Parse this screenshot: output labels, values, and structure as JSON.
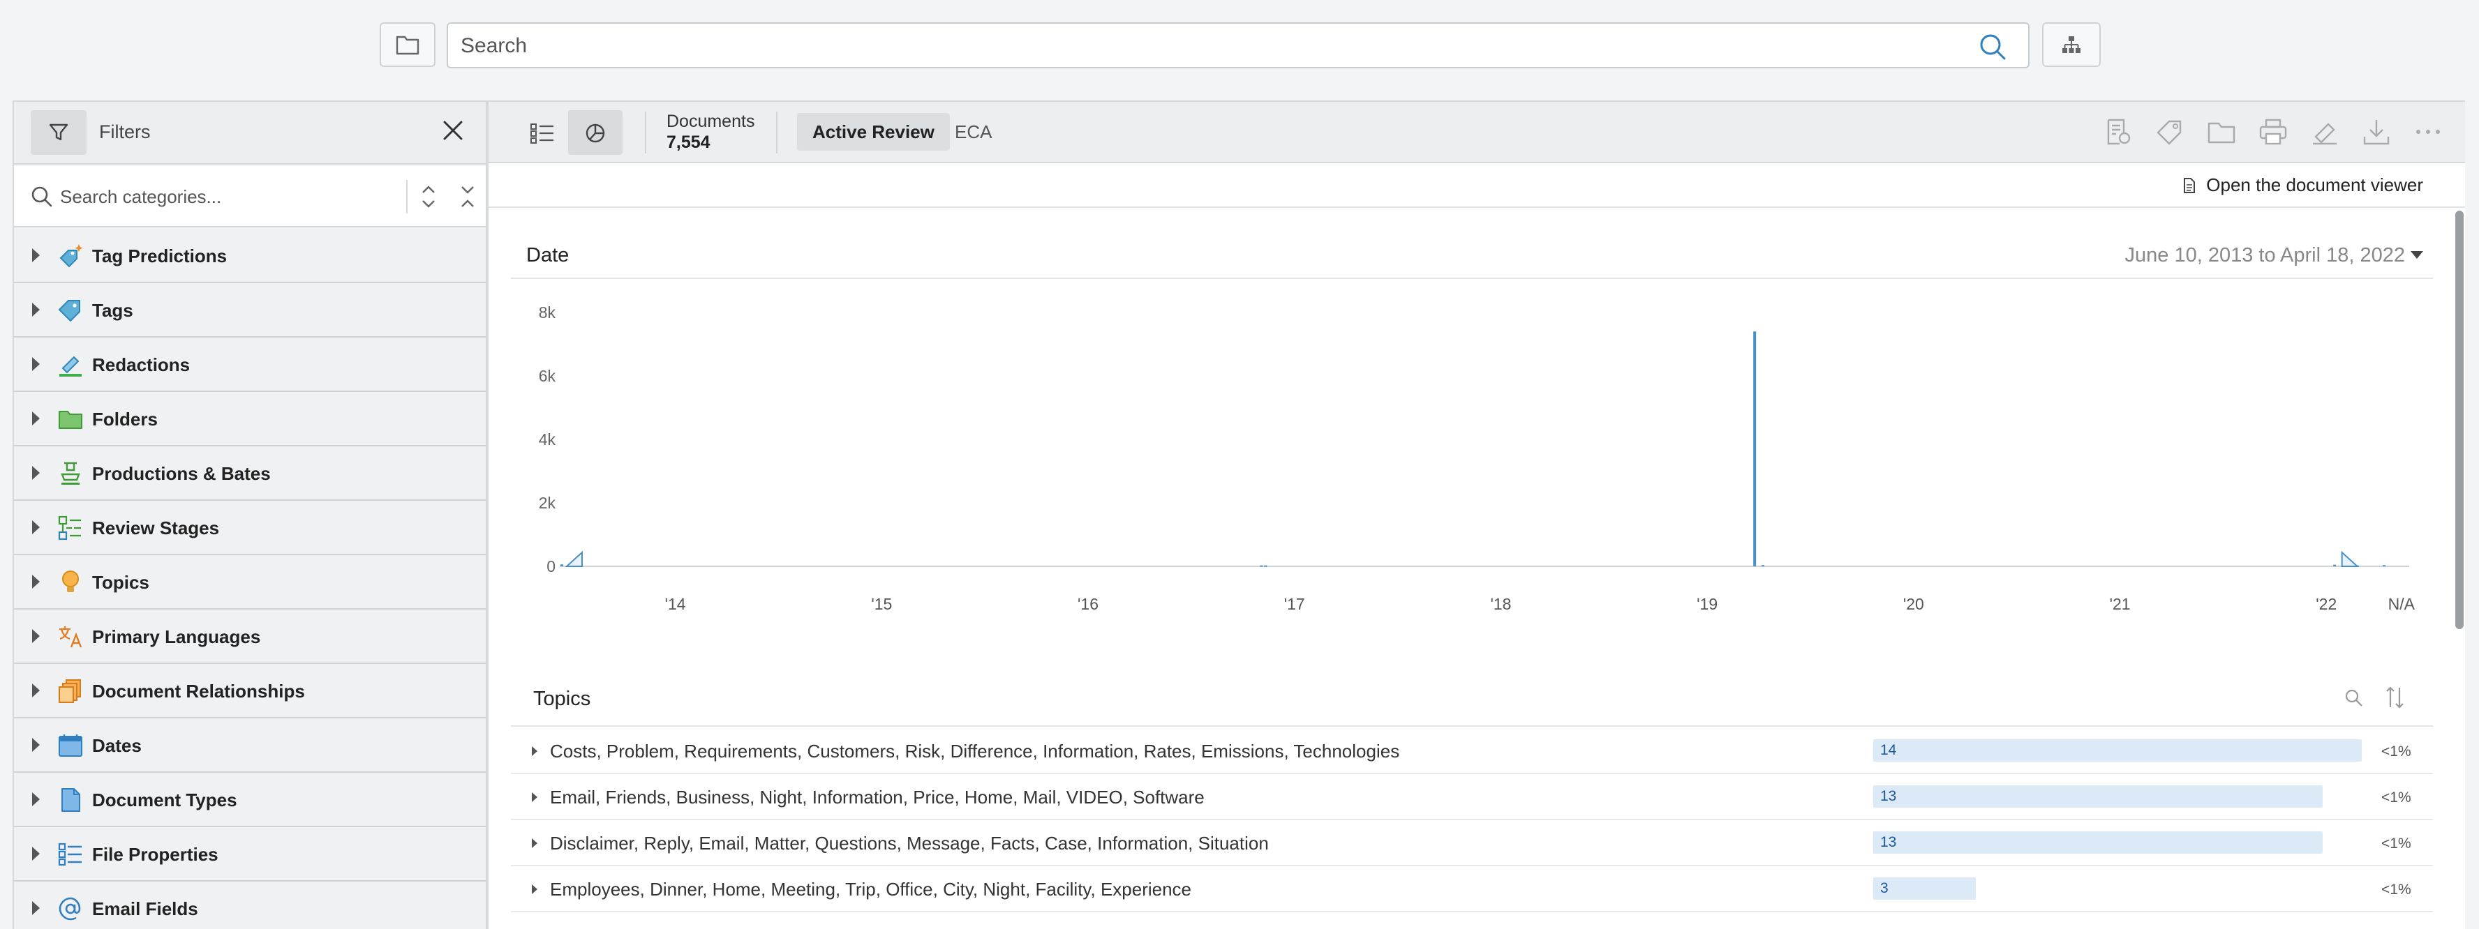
{
  "search": {
    "placeholder": "Search"
  },
  "sidebar": {
    "title": "Filters",
    "search_placeholder": "Search categories...",
    "items": [
      {
        "label": "Tag Predictions",
        "icon": "tag-prediction-icon"
      },
      {
        "label": "Tags",
        "icon": "tag-icon"
      },
      {
        "label": "Redactions",
        "icon": "redaction-marker-icon"
      },
      {
        "label": "Folders",
        "icon": "folder-icon"
      },
      {
        "label": "Productions & Bates",
        "icon": "production-stamp-icon"
      },
      {
        "label": "Review Stages",
        "icon": "review-stages-icon"
      },
      {
        "label": "Topics",
        "icon": "lightbulb-icon"
      },
      {
        "label": "Primary Languages",
        "icon": "language-icon"
      },
      {
        "label": "Document Relationships",
        "icon": "document-relationships-icon"
      },
      {
        "label": "Dates",
        "icon": "calendar-icon"
      },
      {
        "label": "Document Types",
        "icon": "document-type-icon"
      },
      {
        "label": "File Properties",
        "icon": "file-properties-icon"
      },
      {
        "label": "Email Fields",
        "icon": "at-sign-icon"
      }
    ]
  },
  "toolbar": {
    "documents_label": "Documents",
    "documents_count": "7,554",
    "tabs": [
      {
        "label": "Active Review",
        "active": true
      },
      {
        "label": "ECA",
        "active": false
      }
    ],
    "actions": [
      "document-assign-icon",
      "tag-icon",
      "folder-icon",
      "print-icon",
      "redact-icon",
      "download-icon",
      "more-icon"
    ]
  },
  "viewer": {
    "open_label": "Open the document viewer"
  },
  "date_panel": {
    "title": "Date",
    "range": "June 10, 2013 to April 18, 2022"
  },
  "chart_data": {
    "type": "bar",
    "title": "Date",
    "xlabel": "",
    "ylabel": "",
    "y_ticks": [
      "0",
      "2k",
      "4k",
      "6k",
      "8k"
    ],
    "x_ticks": [
      "'14",
      "'15",
      "'16",
      "'17",
      "'18",
      "'19",
      "'20",
      "'21",
      "'22",
      "N/A"
    ],
    "ylim": [
      0,
      8000
    ],
    "xlim": [
      2013.44,
      2022.3
    ],
    "series": [
      {
        "values": [
          {
            "x": 2013.45,
            "y": 60
          },
          {
            "x": 2016.84,
            "y": 30
          },
          {
            "x": 2016.86,
            "y": 30
          },
          {
            "x": 2019.23,
            "y": 7400
          },
          {
            "x": 2019.27,
            "y": 40
          },
          {
            "x": 2022.04,
            "y": 50
          },
          {
            "x": 2022.15,
            "y": 30
          },
          {
            "x": 2022.28,
            "y": 40
          }
        ]
      }
    ],
    "grid": false,
    "color": "#4a90c8"
  },
  "topics": {
    "title": "Topics",
    "rows": [
      {
        "label": "Costs, Problem, Requirements, Customers, Risk, Difference, Information, Rates, Emissions, Technologies",
        "count": "14",
        "percent": "<1%",
        "fraction": 1.0
      },
      {
        "label": "Email, Friends, Business, Night, Information, Price, Home, Mail, VIDEO, Software",
        "count": "13",
        "percent": "<1%",
        "fraction": 0.92
      },
      {
        "label": "Disclaimer, Reply, Email, Matter, Questions, Message, Facts, Case, Information, Situation",
        "count": "13",
        "percent": "<1%",
        "fraction": 0.92
      },
      {
        "label": "Employees, Dinner, Home, Meeting, Trip, Office, City, Night, Facility, Experience",
        "count": "3",
        "percent": "<1%",
        "fraction": 0.21
      }
    ]
  }
}
